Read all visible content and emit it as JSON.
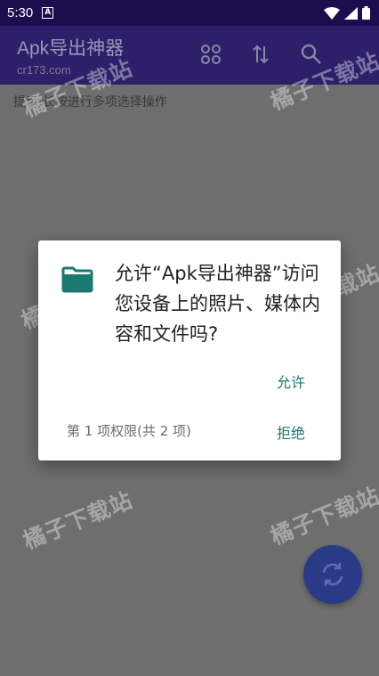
{
  "status": {
    "time": "5:30",
    "notification_icon": "A"
  },
  "app_bar": {
    "title": "Apk导出神器",
    "subtitle": "cr173.com"
  },
  "hint": "提示:长按进行多项选择操作",
  "watermark": "橘子下载站",
  "dialog": {
    "message": "允许“Apk导出神器”访问您设备上的照片、媒体内容和文件吗?",
    "allow_label": "允许",
    "permission_count": "第 1 项权限(共 2 项)",
    "deny_label": "拒绝"
  },
  "colors": {
    "accent": "#1a7a71",
    "app_bar": "#2d1f6a",
    "status_bar": "#1c0d4f",
    "fab": "#2a3a86"
  }
}
